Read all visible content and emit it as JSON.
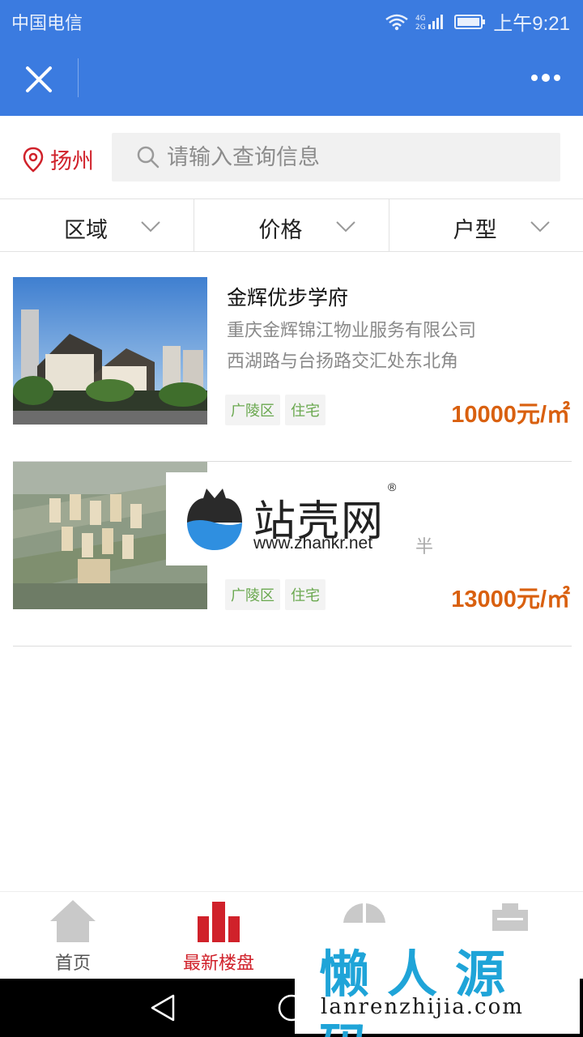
{
  "status_bar": {
    "carrier": "中国电信",
    "network": "4G 2G",
    "time": "上午9:21",
    "icons": [
      "wifi-icon",
      "signal-icon",
      "battery-icon"
    ]
  },
  "titlebar": {
    "close_icon": "close-icon",
    "more_icon": "more-dots-icon"
  },
  "search": {
    "city": "扬州",
    "placeholder": "请输入查询信息"
  },
  "filters": [
    {
      "label": "区域"
    },
    {
      "label": "价格"
    },
    {
      "label": "户型"
    }
  ],
  "listings": [
    {
      "name": "金辉优步学府",
      "company": "重庆金辉锦江物业服务有限公司",
      "address": "西湖路与台扬路交汇处东北角",
      "tags": [
        "广陵区",
        "住宅"
      ],
      "price": "10000元/㎡"
    },
    {
      "name": "",
      "company": "",
      "address": "",
      "tags": [
        "广陵区",
        "住宅"
      ],
      "price": "13000元/㎡"
    }
  ],
  "watermarks": {
    "zhankr_brand": "站壳网",
    "zhankr_reg": "®",
    "zhankr_url": "www.zhankr.net",
    "stray": "半",
    "lanren_cn": "懒人源码",
    "lanren_en": "lanrenzhijia.com"
  },
  "tabbar": [
    {
      "label": "首页",
      "icon": "home-icon",
      "active": false
    },
    {
      "label": "最新楼盘",
      "icon": "buildings-icon",
      "active": true
    },
    {
      "label": "",
      "icon": "pie-icon",
      "active": false
    },
    {
      "label": "",
      "icon": "briefcase-icon",
      "active": false
    }
  ],
  "colors": {
    "header_blue": "#3b7be0",
    "accent_red": "#d0212a",
    "price_orange": "#d9600f",
    "tag_green": "#6aa84f"
  }
}
